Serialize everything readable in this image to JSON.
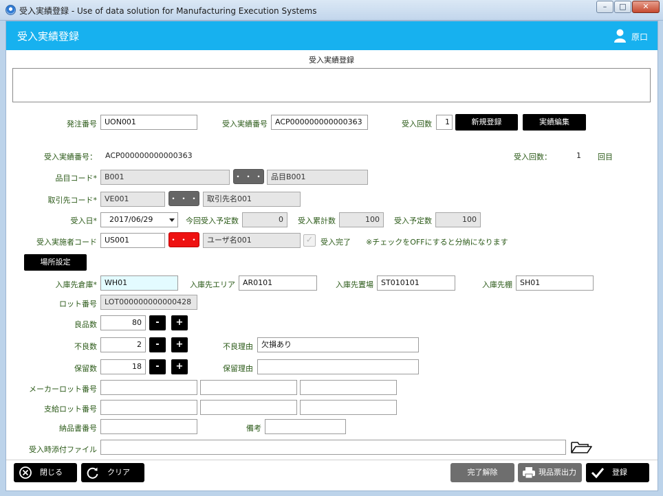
{
  "window": {
    "title": "受入実績登録 - Use of data solution for Manufacturing Execution Systems",
    "minimize": "–",
    "maximize": "□",
    "close": "✕"
  },
  "header": {
    "title": "受入実績登録",
    "user": "原口"
  },
  "section_title": "受入実績登録",
  "search": {
    "order_no_label": "発注番号",
    "order_no": "UON001",
    "receipt_no_label": "受入実績番号",
    "receipt_no": "ACP000000000000363",
    "count_label": "受入回数",
    "count": "1",
    "new_button": "新規登録",
    "edit_button": "実績編集"
  },
  "info": {
    "receipt_no_label": "受入実績番号：",
    "receipt_no": "ACP000000000000363",
    "count_label": "受入回数：",
    "count": "1",
    "count_unit": "回目"
  },
  "form": {
    "item_code_label": "品目コード*",
    "item_code": "B001",
    "item_name": "品目B001",
    "supplier_label": "取引先コード*",
    "supplier_code": "VE001",
    "supplier_name": "取引先名001",
    "dots": "・・・",
    "date_label": "受入日*",
    "date": "2017/06/29",
    "planned_today_label": "今回受入予定数",
    "planned_today": "0",
    "cumulative_label": "受入累計数",
    "cumulative": "100",
    "planned_label": "受入予定数",
    "planned": "100",
    "operator_label": "受入実施者コード",
    "operator_code": "US001",
    "operator_name": "ユーザ名001",
    "complete_label": "受入完了",
    "complete_checked": true,
    "check": "✓",
    "complete_note": "※チェックをOFFにすると分納になります",
    "location_button": "場所設定",
    "warehouse_label": "入庫先倉庫*",
    "warehouse": "WH01",
    "area_label": "入庫先エリア",
    "area": "AR0101",
    "place_label": "入庫先置場",
    "place": "ST010101",
    "shelf_label": "入庫先棚",
    "shelf": "SH01",
    "lot_label": "ロット番号",
    "lot": "LOT000000000000428",
    "good_label": "良品数",
    "good": "80",
    "defect_label": "不良数",
    "defect": "2",
    "defect_reason_label": "不良理由",
    "defect_reason": "欠損あり",
    "hold_label": "保留数",
    "hold": "18",
    "hold_reason_label": "保留理由",
    "hold_reason": "",
    "maker_lot_label": "メーカーロット番号",
    "supply_lot_label": "支給ロット番号",
    "delivery_label": "納品書番号",
    "delivery": "",
    "remarks_label": "備考",
    "remarks": "",
    "attach_label": "受入時添付ファイル",
    "attach": "",
    "minus": "-",
    "plus": "+"
  },
  "footer": {
    "close": "閉じる",
    "clear": "クリア",
    "cancel_complete": "完了解除",
    "print": "現品票出力",
    "register": "登録"
  },
  "colors": {
    "header": "#17b1ef",
    "label": "#2b5a18",
    "dots_red": "#e11111"
  }
}
